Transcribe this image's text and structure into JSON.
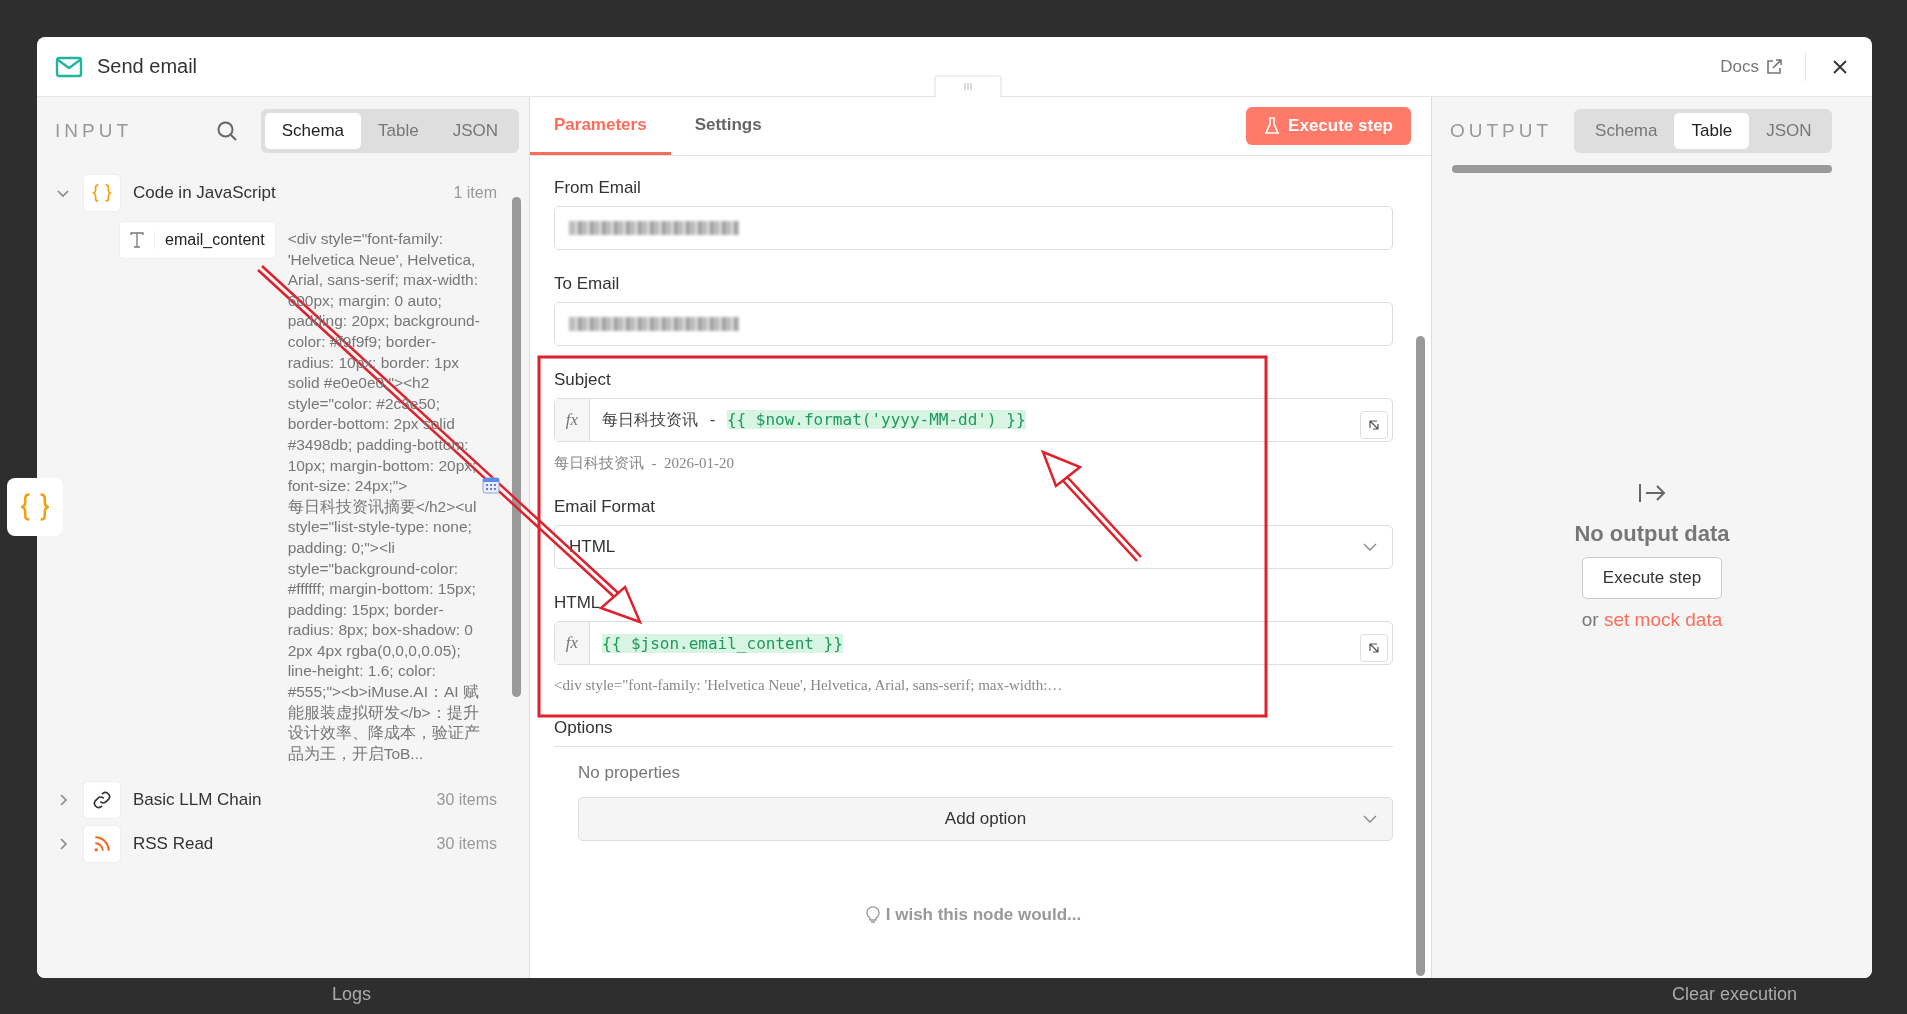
{
  "background": {
    "logs_label": "Logs",
    "clear_label": "Clear execution"
  },
  "window": {
    "title": "Send email",
    "docs_label": "Docs"
  },
  "input": {
    "title": "INPUT",
    "tabs": [
      {
        "label": "Schema",
        "selected": true
      },
      {
        "label": "Table",
        "selected": false
      },
      {
        "label": "JSON",
        "selected": false
      }
    ],
    "nodes": [
      {
        "name": "Code in JavaScript",
        "count": "1 item",
        "expanded": true,
        "kind": "code",
        "fields": [
          {
            "name": "email_content",
            "value_before": "<div style=\"font-family: 'Helvetica Neue', Helvetica, Arial, sans-serif; max-width: 600px; margin: 0 auto; padding: 20px; background-color: #f9f9f9; border-radius: 10px; border: 1px solid #e0e0e0;\"><h2 style=\"color: #2c3e50; border-bottom: 2px solid #3498db; padding-bottom: 10px; margin-bottom: 20px; font-size: 24px;\">",
            "value_after": "每日科技资讯摘要</h2><ul style=\"list-style-type: none; padding: 0;\"><li style=\"background-color: #ffffff; margin-bottom: 15px; padding: 15px; border-radius: 8px; box-shadow: 0 2px 4px rgba(0,0,0,0.05); line-height: 1.6; color: #555;\"><b>iMuse.AI：AI 赋能服装虚拟研发</b>：提升设计效率、降成本，验证产品为王，开启ToB..."
          }
        ]
      },
      {
        "name": "Basic LLM Chain",
        "count": "30 items",
        "expanded": false,
        "kind": "chain"
      },
      {
        "name": "RSS Read",
        "count": "30 items",
        "expanded": false,
        "kind": "rss"
      }
    ]
  },
  "parameters": {
    "tabs": [
      {
        "label": "Parameters",
        "selected": true
      },
      {
        "label": "Settings",
        "selected": false
      }
    ],
    "execute_label": "Execute step",
    "fields": [
      {
        "label": "From Email",
        "kind": "redacted"
      },
      {
        "label": "To Email",
        "kind": "redacted"
      },
      {
        "label": "Subject",
        "kind": "expression",
        "fx_label": "fx",
        "prefix": "每日科技资讯 - ",
        "expression": "{{ $now.format('yyyy-MM-dd') }}",
        "preview": "每日科技资讯  -  2026-01-20"
      },
      {
        "label": "Email Format",
        "kind": "select",
        "value": "HTML"
      },
      {
        "label": "HTML",
        "kind": "expression",
        "fx_label": "fx",
        "expression": "{{ $json.email_content }}",
        "preview": "<div style=\"font-family: 'Helvetica Neue', Helvetica, Arial, sans-serif; max-width:…"
      }
    ],
    "options": {
      "label": "Options",
      "empty": "No properties",
      "add_label": "Add option"
    },
    "feedback": "I wish this node would..."
  },
  "output": {
    "title": "OUTPUT",
    "tabs": [
      {
        "label": "Schema",
        "selected": false
      },
      {
        "label": "Table",
        "selected": true
      },
      {
        "label": "JSON",
        "selected": false
      }
    ],
    "empty_title": "No output data",
    "execute_label": "Execute step",
    "or_text": "or",
    "mock_link": "set mock data"
  }
}
